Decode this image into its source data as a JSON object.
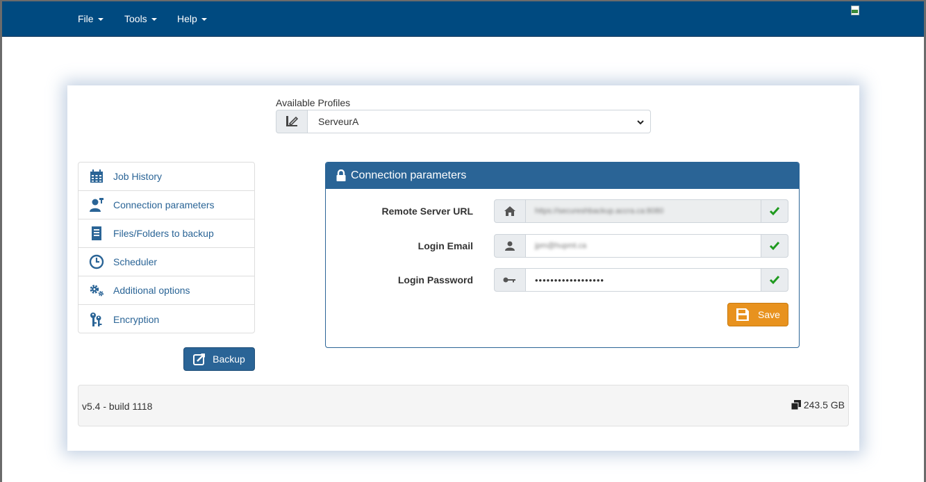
{
  "menubar": {
    "items": [
      {
        "label": "File"
      },
      {
        "label": "Tools"
      },
      {
        "label": "Help"
      }
    ]
  },
  "profiles": {
    "label": "Available Profiles",
    "selected": "ServeurA"
  },
  "sidebar": {
    "items": [
      {
        "label": "Job History",
        "icon": "calendar-icon"
      },
      {
        "label": "Connection parameters",
        "icon": "user-plug-icon"
      },
      {
        "label": "Files/Folders to backup",
        "icon": "document-icon"
      },
      {
        "label": "Scheduler",
        "icon": "clock-icon"
      },
      {
        "label": "Additional options",
        "icon": "gears-icon"
      },
      {
        "label": "Encryption",
        "icon": "keys-icon"
      }
    ],
    "backup_label": "Backup"
  },
  "connection": {
    "title": "Connection parameters",
    "fields": [
      {
        "label": "Remote Server URL",
        "value": "https://secureshbackup.accra.ca:8080",
        "icon": "home-icon"
      },
      {
        "label": "Login Email",
        "value": "jpm@hupmt.ca",
        "icon": "user-icon"
      },
      {
        "label": "Login Password",
        "value": "••••••••••••••••••",
        "icon": "key-icon"
      }
    ],
    "save_label": "Save"
  },
  "footer": {
    "version": "v5.4 - build 1118",
    "storage": "243.5 GB"
  },
  "colors": {
    "navbar": "#004a80",
    "primary": "#2a6496",
    "save": "#e8921e",
    "check": "#1f9a1f"
  }
}
